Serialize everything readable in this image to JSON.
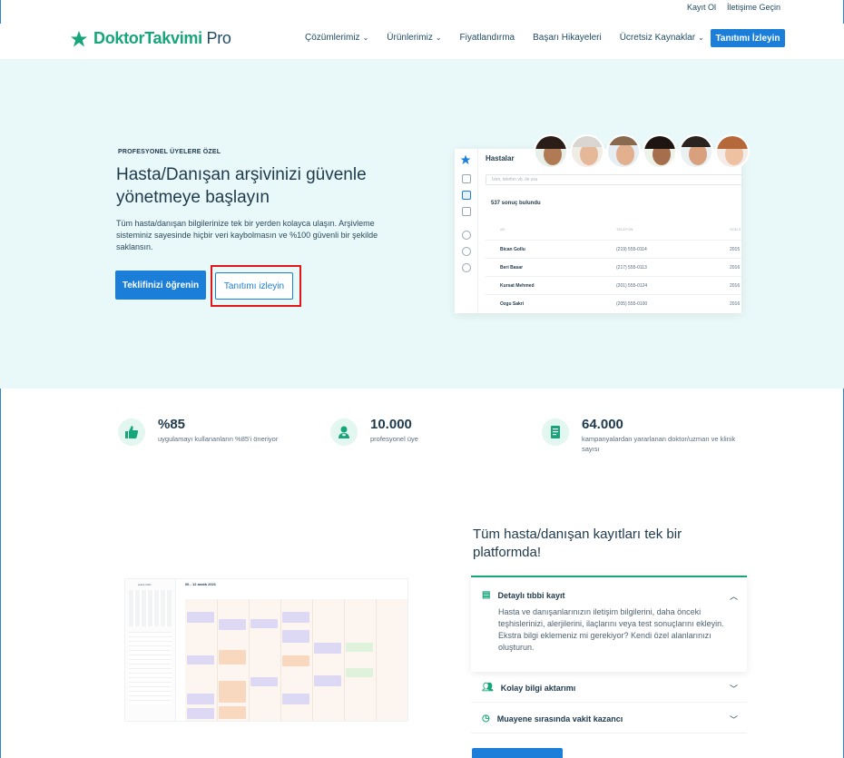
{
  "topbar": {
    "register": "Kayıt Ol",
    "contact": "İletişime Geçin"
  },
  "nav": {
    "logo_main": "DoktorTakvimi",
    "logo_pro": "Pro",
    "items": [
      {
        "label": "Çözümlerimiz",
        "has_dropdown": true
      },
      {
        "label": "Ürünlerimiz",
        "has_dropdown": true
      },
      {
        "label": "Fiyatlandırma",
        "has_dropdown": false
      },
      {
        "label": "Başarı Hikayeleri",
        "has_dropdown": false
      },
      {
        "label": "Ücretsiz Kaynaklar",
        "has_dropdown": true
      }
    ],
    "cta": "Tanıtımı İzleyin"
  },
  "hero": {
    "eyebrow": "PROFESYONEL ÜYELERE ÖZEL",
    "title": "Hasta/Danışan arşivinizi güvenle yönetmeye başlayın",
    "description": "Tüm hasta/danışan bilgilerinize tek bir yerden kolayca ulaşın. Arşivleme sisteminiz sayesinde hiçbir veri kaybolmasın ve %100 güvenli bir şekilde saklansın.",
    "primary_button": "Teklifinizi öğrenin",
    "secondary_button": "Tanıtımı izleyin"
  },
  "mockup": {
    "title": "Hastalar",
    "search_placeholder": "İsim, telefon vb. ile ara",
    "result_count": "537 sonuç bulundu",
    "col_name": "AD",
    "col_phone": "TELEFON",
    "col_last": "SON Z",
    "rows": [
      {
        "name": "Bican Gollu",
        "phone": "(219) 555-0114",
        "year": "2015"
      },
      {
        "name": "Beri Basar",
        "phone": "(217) 555-0113",
        "year": "2016"
      },
      {
        "name": "Kursat Mehmed",
        "phone": "(201) 555-0124",
        "year": "2016"
      },
      {
        "name": "Ozgu Sakri",
        "phone": "(205) 555-0100",
        "year": "2016"
      }
    ]
  },
  "stats": [
    {
      "icon": "thumbs-up-icon",
      "value": "%85",
      "label": "uygulamayı kullananların %85'i öneriyor"
    },
    {
      "icon": "doctor-icon",
      "value": "10.000",
      "label": "profesyonel üye"
    },
    {
      "icon": "document-icon",
      "value": "64.000",
      "label": "kampanyalardan yararlanan doktor/uzman ve klinik sayısı"
    }
  ],
  "calendar": {
    "range": "06 - 12 aralık 2021",
    "month": "aralık 2021"
  },
  "features": {
    "title": "Tüm hasta/danışan kayıtları tek bir platformda!",
    "items": [
      {
        "label": "Detaylı tıbbi kayıt",
        "icon": "clipboard-icon",
        "expanded": true,
        "body": "Hasta ve danışanlarınızın iletişim bilgilerini, daha önceki teşhislerinizi, alerjilerini, ilaçlarını veya test sonuçlarını ekleyin. Ekstra bilgi eklemeniz mi gerekiyor? Kendi özel alanlarınızı oluşturun."
      },
      {
        "label": "Kolay bilgi aktarımı",
        "icon": "users-icon",
        "expanded": false
      },
      {
        "label": "Muayene sırasında vakit kazancı",
        "icon": "clock-icon",
        "expanded": false
      }
    ]
  },
  "colors": {
    "brand_green": "#17a57a",
    "brand_blue": "#1b7fd9",
    "hero_bg": "#e9f8f8",
    "highlight_red": "#e0161b"
  }
}
